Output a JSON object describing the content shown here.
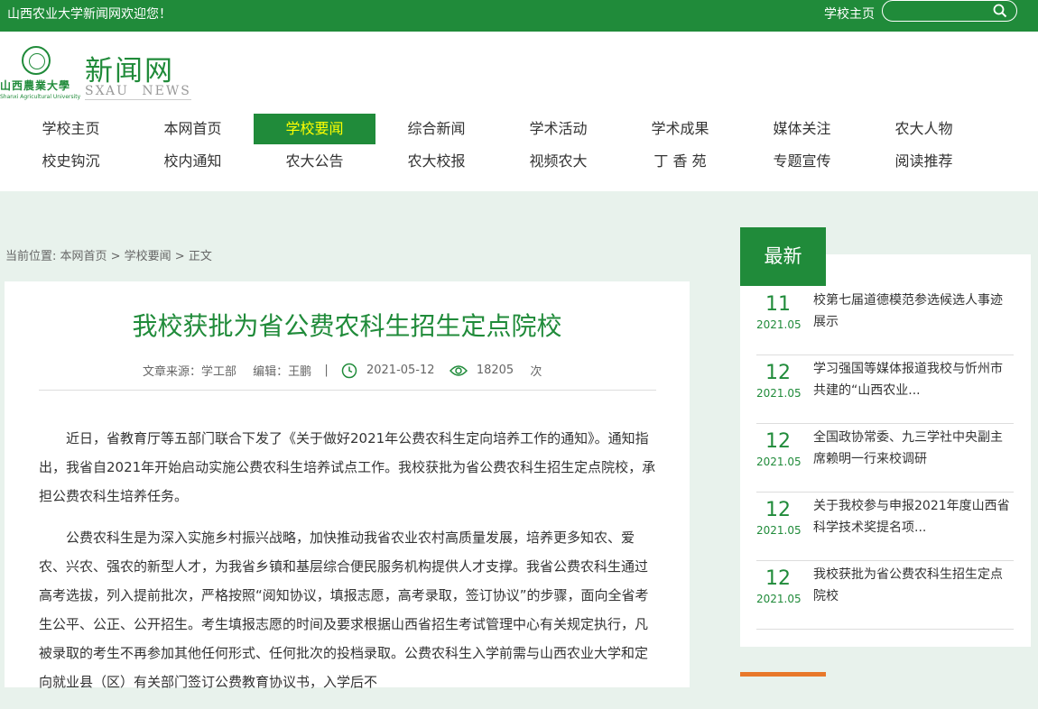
{
  "topbar": {
    "welcome": "山西农业大学新闻网欢迎您！",
    "home_link": "学校主页",
    "search_placeholder": ""
  },
  "header": {
    "logo_cn": "山西農業大學",
    "logo_en": "Shanxi Agricultural University",
    "site_title": "新闻网",
    "site_subtitle": "SXAU NEWS"
  },
  "nav": {
    "row1": [
      "学校主页",
      "本网首页",
      "学校要闻",
      "综合新闻",
      "学术活动",
      "学术成果",
      "媒体关注",
      "农大人物"
    ],
    "row2": [
      "校史钩沉",
      "校内通知",
      "农大公告",
      "农大校报",
      "视频农大",
      "丁 香 苑",
      "专题宣传",
      "阅读推荐"
    ],
    "active": "学校要闻"
  },
  "breadcrumb": "当前位置: 本网首页 > 学校要闻 > 正文",
  "article": {
    "title": "我校获批为省公费农科生招生定点院校",
    "source": "文章来源：学工部",
    "editor": "编辑：王鹏",
    "date": "2021-05-12",
    "views": "18205",
    "views_unit": "次",
    "paragraphs": [
      "近日，省教育厅等五部门联合下发了《关于做好2021年公费农科生定向培养工作的通知》。通知指出，我省自2021年开始启动实施公费农科生培养试点工作。我校获批为省公费农科生招生定点院校，承担公费农科生培养任务。",
      "公费农科生是为深入实施乡村振兴战略，加快推动我省农业农村高质量发展，培养更多知农、爱农、兴农、强农的新型人才，为我省乡镇和基层综合便民服务机构提供人才支撑。我省公费农科生通过高考选拔，列入提前批次，严格按照“阅知协议，填报志愿，高考录取，签订协议”的步骤，面向全省考生公平、公正、公开招生。考生填报志愿的时间及要求根据山西省招生考试管理中心有关规定执行，凡被录取的考生不再参加其他任何形式、任何批次的投档录取。公费农科生入学前需与山西农业大学和定向就业县（区）有关部门签订公费教育协议书，入学后不"
    ]
  },
  "sidebar": {
    "heading": "最新",
    "items": [
      {
        "day": "11",
        "ym": "2021.05",
        "title": "校第七届道德模范参选候选人事迹展示"
      },
      {
        "day": "12",
        "ym": "2021.05",
        "title": "学习强国等媒体报道我校与忻州市共建的“山西农业..."
      },
      {
        "day": "12",
        "ym": "2021.05",
        "title": "全国政协常委、九三学社中央副主席赖明一行来校调研"
      },
      {
        "day": "12",
        "ym": "2021.05",
        "title": "关于我校参与申报2021年度山西省科学技术奖提名项..."
      },
      {
        "day": "12",
        "ym": "2021.05",
        "title": "我校获批为省公费农科生招生定点院校"
      }
    ]
  }
}
